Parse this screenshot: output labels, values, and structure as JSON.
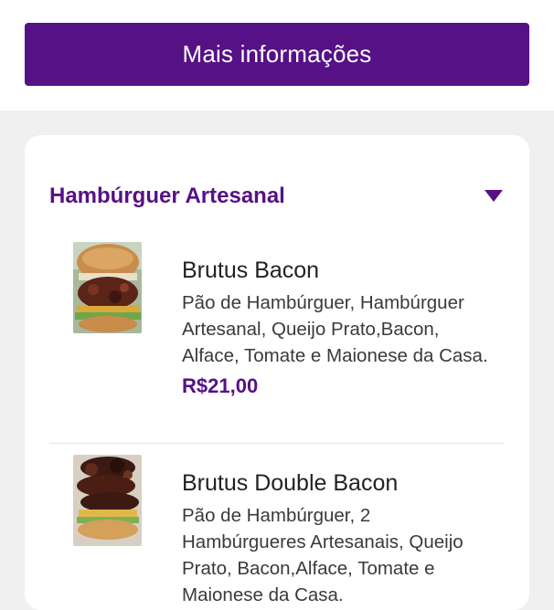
{
  "header": {
    "more_info_label": "Mais informações"
  },
  "category": {
    "title": "Hambúrguer Artesanal"
  },
  "products": [
    {
      "name": "Brutus Bacon",
      "description": "Pão de Hambúrguer, Hambúrguer Artesanal, Queijo Prato,Bacon, Alface, Tomate e Maionese da Casa.",
      "price": "R$21,00"
    },
    {
      "name": "Brutus Double Bacon",
      "description": "Pão de Hambúrguer, 2 Hambúrgueres Artesanais, Queijo Prato, Bacon,Alface, Tomate e Maionese da Casa."
    }
  ],
  "colors": {
    "brand": "#561186",
    "page_background": "#f0f0f0",
    "card_background": "#ffffff"
  }
}
